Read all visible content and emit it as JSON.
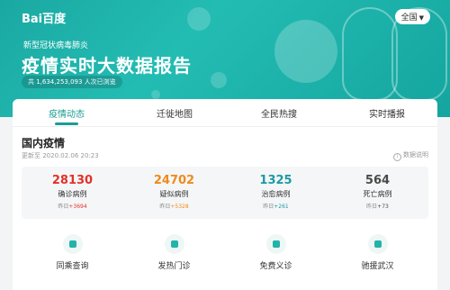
{
  "header": {
    "logo_text": "Bai百度",
    "region_button": "全国",
    "subtitle": "新型冠状病毒肺炎",
    "title": "疫情实时大数据报告",
    "views": "共 1,634,253,093 人次已浏览"
  },
  "tabs": [
    {
      "label": "疫情动态",
      "active": true
    },
    {
      "label": "迁徙地图",
      "active": false
    },
    {
      "label": "全民热搜",
      "active": false
    },
    {
      "label": "实时播报",
      "active": false
    }
  ],
  "domestic": {
    "title": "国内疫情",
    "updated": "更新至 2020.02.06 20:23",
    "data_note": "数据说明",
    "stats": [
      {
        "value": "28130",
        "label": "确诊病例",
        "prev_label": "昨日",
        "delta": "+3694",
        "color": "#e0332a"
      },
      {
        "value": "24702",
        "label": "疑似病例",
        "prev_label": "昨日",
        "delta": "+5328",
        "color": "#f08a1b"
      },
      {
        "value": "1325",
        "label": "治愈病例",
        "prev_label": "昨日",
        "delta": "+261",
        "color": "#1c9aa4"
      },
      {
        "value": "564",
        "label": "死亡病例",
        "prev_label": "昨日",
        "delta": "+73",
        "color": "#4a4a4a"
      }
    ]
  },
  "quick_links": [
    {
      "label": "同乘查询",
      "icon": "person-icon"
    },
    {
      "label": "发热门诊",
      "icon": "location-icon"
    },
    {
      "label": "免费义诊",
      "icon": "chat-icon"
    },
    {
      "label": "驰援武汉",
      "icon": "heart-icon"
    }
  ]
}
